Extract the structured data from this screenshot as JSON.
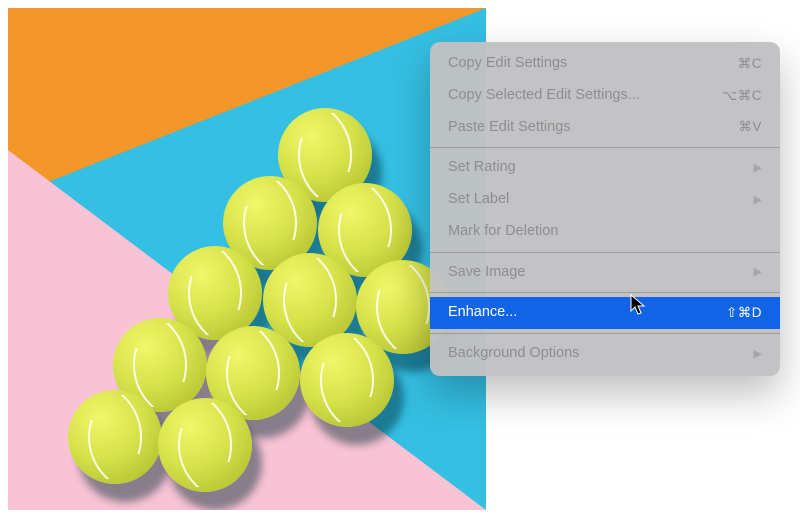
{
  "photo": {
    "description": "Tennis balls arranged in a triangle on diagonal orange, cyan and pink color blocks"
  },
  "menu": {
    "items": [
      {
        "label": "Copy Edit Settings",
        "shortcut": "⌘C",
        "disabled": true,
        "submenu": false
      },
      {
        "label": "Copy Selected Edit Settings...",
        "shortcut": "⌥⌘C",
        "disabled": true,
        "submenu": false
      },
      {
        "label": "Paste Edit Settings",
        "shortcut": "⌘V",
        "disabled": true,
        "submenu": false
      },
      {
        "sep": true
      },
      {
        "label": "Set Rating",
        "shortcut": "",
        "disabled": true,
        "submenu": true
      },
      {
        "label": "Set Label",
        "shortcut": "",
        "disabled": true,
        "submenu": true
      },
      {
        "label": "Mark for Deletion",
        "shortcut": "",
        "disabled": true,
        "submenu": false
      },
      {
        "sep": true
      },
      {
        "label": "Save Image",
        "shortcut": "",
        "disabled": true,
        "submenu": true
      },
      {
        "sep": true
      },
      {
        "label": "Enhance...",
        "shortcut": "⇧⌘D",
        "disabled": false,
        "submenu": false,
        "highlight": true
      },
      {
        "sep": true
      },
      {
        "label": "Background Options",
        "shortcut": "",
        "disabled": true,
        "submenu": true
      }
    ]
  }
}
